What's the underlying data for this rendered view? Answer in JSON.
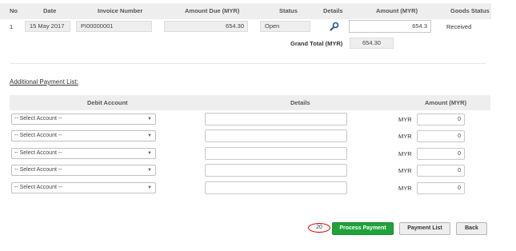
{
  "invoice_table": {
    "headers": [
      "No",
      "Date",
      "Invoice Number",
      "Amount Due (MYR)",
      "Status",
      "Details",
      "Amount (MYR)",
      "Goods Status"
    ],
    "row": {
      "no": "1",
      "date": "15 May 2017",
      "invoice_number": "PI00000001",
      "amount_due": "654.30",
      "status": "Open",
      "details_icon": "search-icon",
      "amount": "654.3",
      "goods_status": "Received"
    },
    "grand_total_label": "Grand Total (MYR)",
    "grand_total_value": "654.30"
  },
  "additional_payment": {
    "title": "Additional Payment List:",
    "headers": [
      "Debit Account",
      "Details",
      "Amount (MYR)"
    ],
    "rows": [
      {
        "account": "-- Select Account --",
        "currency": "MYR",
        "amount": "0"
      },
      {
        "account": "-- Select Account --",
        "currency": "MYR",
        "amount": "0"
      },
      {
        "account": "-- Select Account --",
        "currency": "MYR",
        "amount": "0"
      },
      {
        "account": "-- Select Account --",
        "currency": "MYR",
        "amount": "0"
      },
      {
        "account": "-- Select Account --",
        "currency": "MYR",
        "amount": "0"
      }
    ]
  },
  "actions": {
    "badge": "20",
    "process_payment": "Process Payment",
    "payment_list": "Payment List",
    "back": "Back"
  },
  "colors": {
    "primary_button": "#1fa23a",
    "badge_outline": "#d40000",
    "header_bg": "#eeeeee"
  }
}
